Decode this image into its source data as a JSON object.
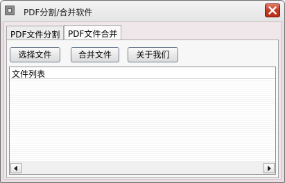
{
  "window": {
    "title": "PDF分割/合并软件"
  },
  "tabs": [
    {
      "label": "PDF文件分割",
      "active": false
    },
    {
      "label": "PDF文件合并",
      "active": true
    }
  ],
  "toolbar": {
    "select_label": "选择文件",
    "merge_label": "合并文件",
    "about_label": "关于我们"
  },
  "file_list": {
    "column_header": "文件列表",
    "rows": []
  },
  "icons": {
    "app": "app-window-icon",
    "close": "close-icon",
    "scroll_left": "arrow-left-icon",
    "scroll_right": "arrow-right-icon"
  },
  "colors": {
    "close_button": "#c23b22",
    "frame": "#e9dfe3"
  }
}
